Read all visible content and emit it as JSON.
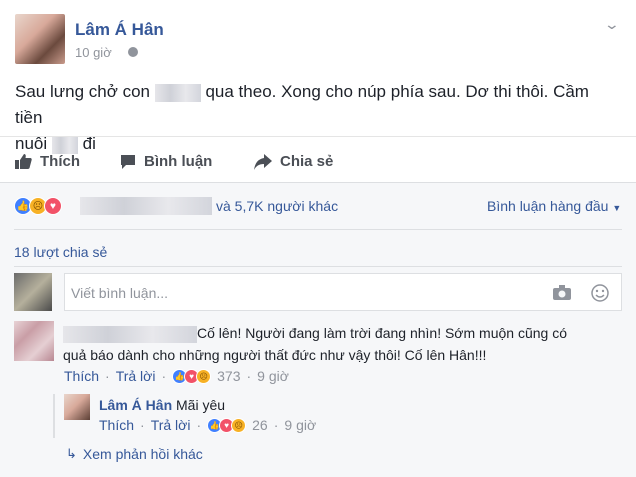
{
  "post": {
    "author": "Lâm Á Hân",
    "time": "10 giờ",
    "text_part1": "Sau lưng chở con",
    "text_part2": "qua theo. Xong cho núp phía sau. Dơ thi thôi. Cầm tiền",
    "text_part3": "nuôi",
    "text_part4": "đi"
  },
  "actions": {
    "like": "Thích",
    "comment": "Bình luận",
    "share": "Chia sẻ"
  },
  "reactions": {
    "others": "và 5,7K người khác",
    "sort_label": "Bình luận hàng đầu"
  },
  "shares": "18 lượt chia sẻ",
  "comment_input": {
    "placeholder": "Viết bình luận..."
  },
  "comments": [
    {
      "text_line1": "Cố lên! Người đang làm trời đang nhìn! Sớm muộn cũng có",
      "text_line2": "quả báo dành cho những người thất đức như vậy thôi! Cố lên Hân!!!",
      "like": "Thích",
      "reply": "Trả lời",
      "reaction_count": "373",
      "time": "9 giờ"
    }
  ],
  "reply": {
    "author": "Lâm Á Hân",
    "text": "Mãi yêu",
    "like": "Thích",
    "reply": "Trả lời",
    "reaction_count": "26",
    "time": "9 giờ"
  },
  "more_replies": "Xem phản hồi khác",
  "colors": {
    "link": "#365899",
    "like_blue": "#4080ff",
    "love_red": "#f25268",
    "sad_yellow": "#f7b125"
  }
}
